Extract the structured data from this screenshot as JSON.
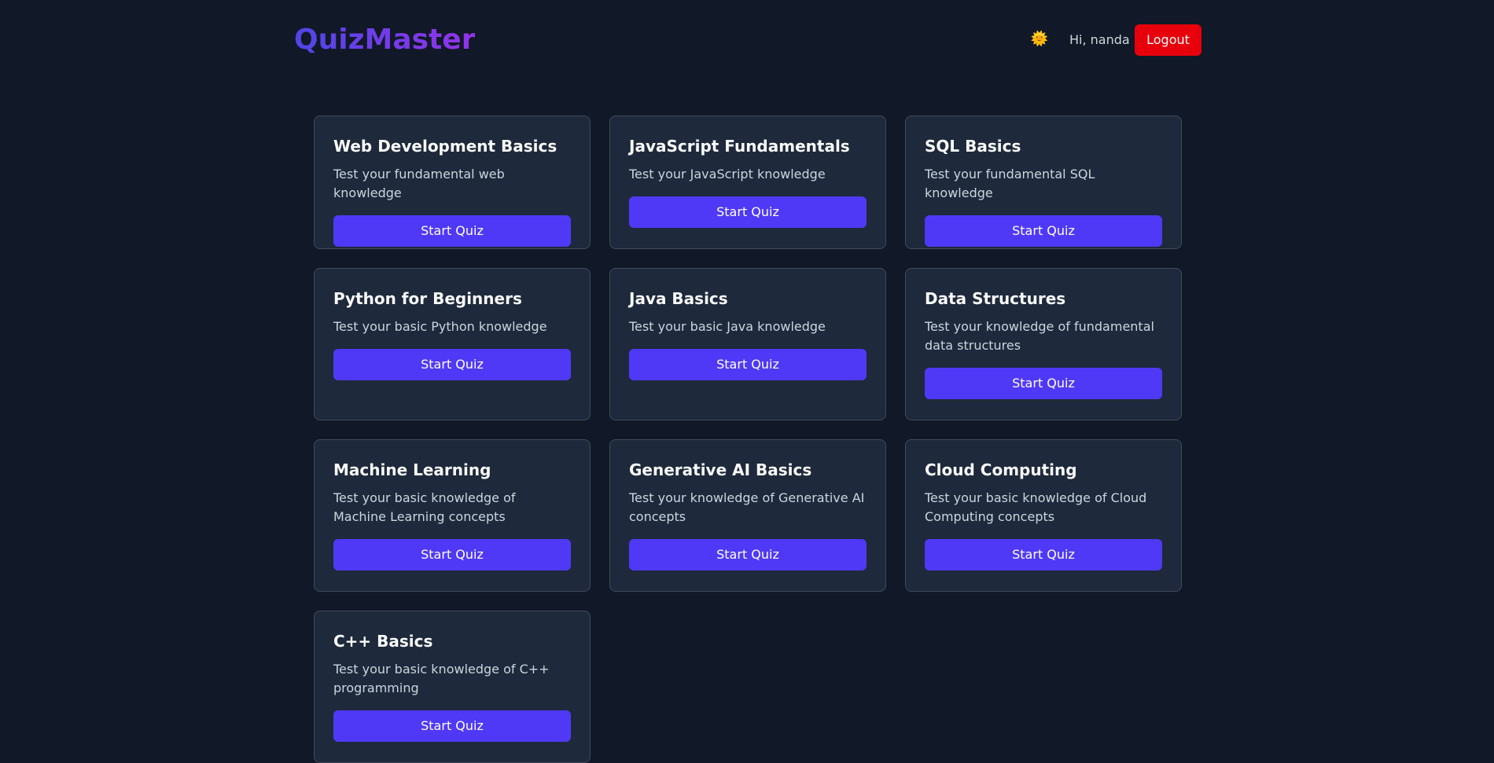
{
  "header": {
    "logo": "QuizMaster",
    "theme_icon": "sun-icon",
    "theme_glyph": "🌞",
    "greeting": "Hi, nanda",
    "logout_label": "Logout"
  },
  "colors": {
    "background": "#111827",
    "card": "#1e293b",
    "accent": "#4f39f6",
    "logout": "#e7000b"
  },
  "quizzes": [
    {
      "title": "Web Development Basics",
      "description": "Test your fundamental web knowledge",
      "button": "Start Quiz"
    },
    {
      "title": "JavaScript Fundamentals",
      "description": "Test your JavaScript knowledge",
      "button": "Start Quiz"
    },
    {
      "title": "SQL Basics",
      "description": "Test your fundamental SQL knowledge",
      "button": "Start Quiz"
    },
    {
      "title": "Python for Beginners",
      "description": "Test your basic Python knowledge",
      "button": "Start Quiz"
    },
    {
      "title": "Java Basics",
      "description": "Test your basic Java knowledge",
      "button": "Start Quiz"
    },
    {
      "title": "Data Structures",
      "description": "Test your knowledge of fundamental data structures",
      "button": "Start Quiz"
    },
    {
      "title": "Machine Learning",
      "description": "Test your basic knowledge of Machine Learning concepts",
      "button": "Start Quiz"
    },
    {
      "title": "Generative AI Basics",
      "description": "Test your knowledge of Generative AI concepts",
      "button": "Start Quiz"
    },
    {
      "title": "Cloud Computing",
      "description": "Test your basic knowledge of Cloud Computing concepts",
      "button": "Start Quiz"
    },
    {
      "title": "C++ Basics",
      "description": "Test your basic knowledge of C++ programming",
      "button": "Start Quiz"
    }
  ]
}
